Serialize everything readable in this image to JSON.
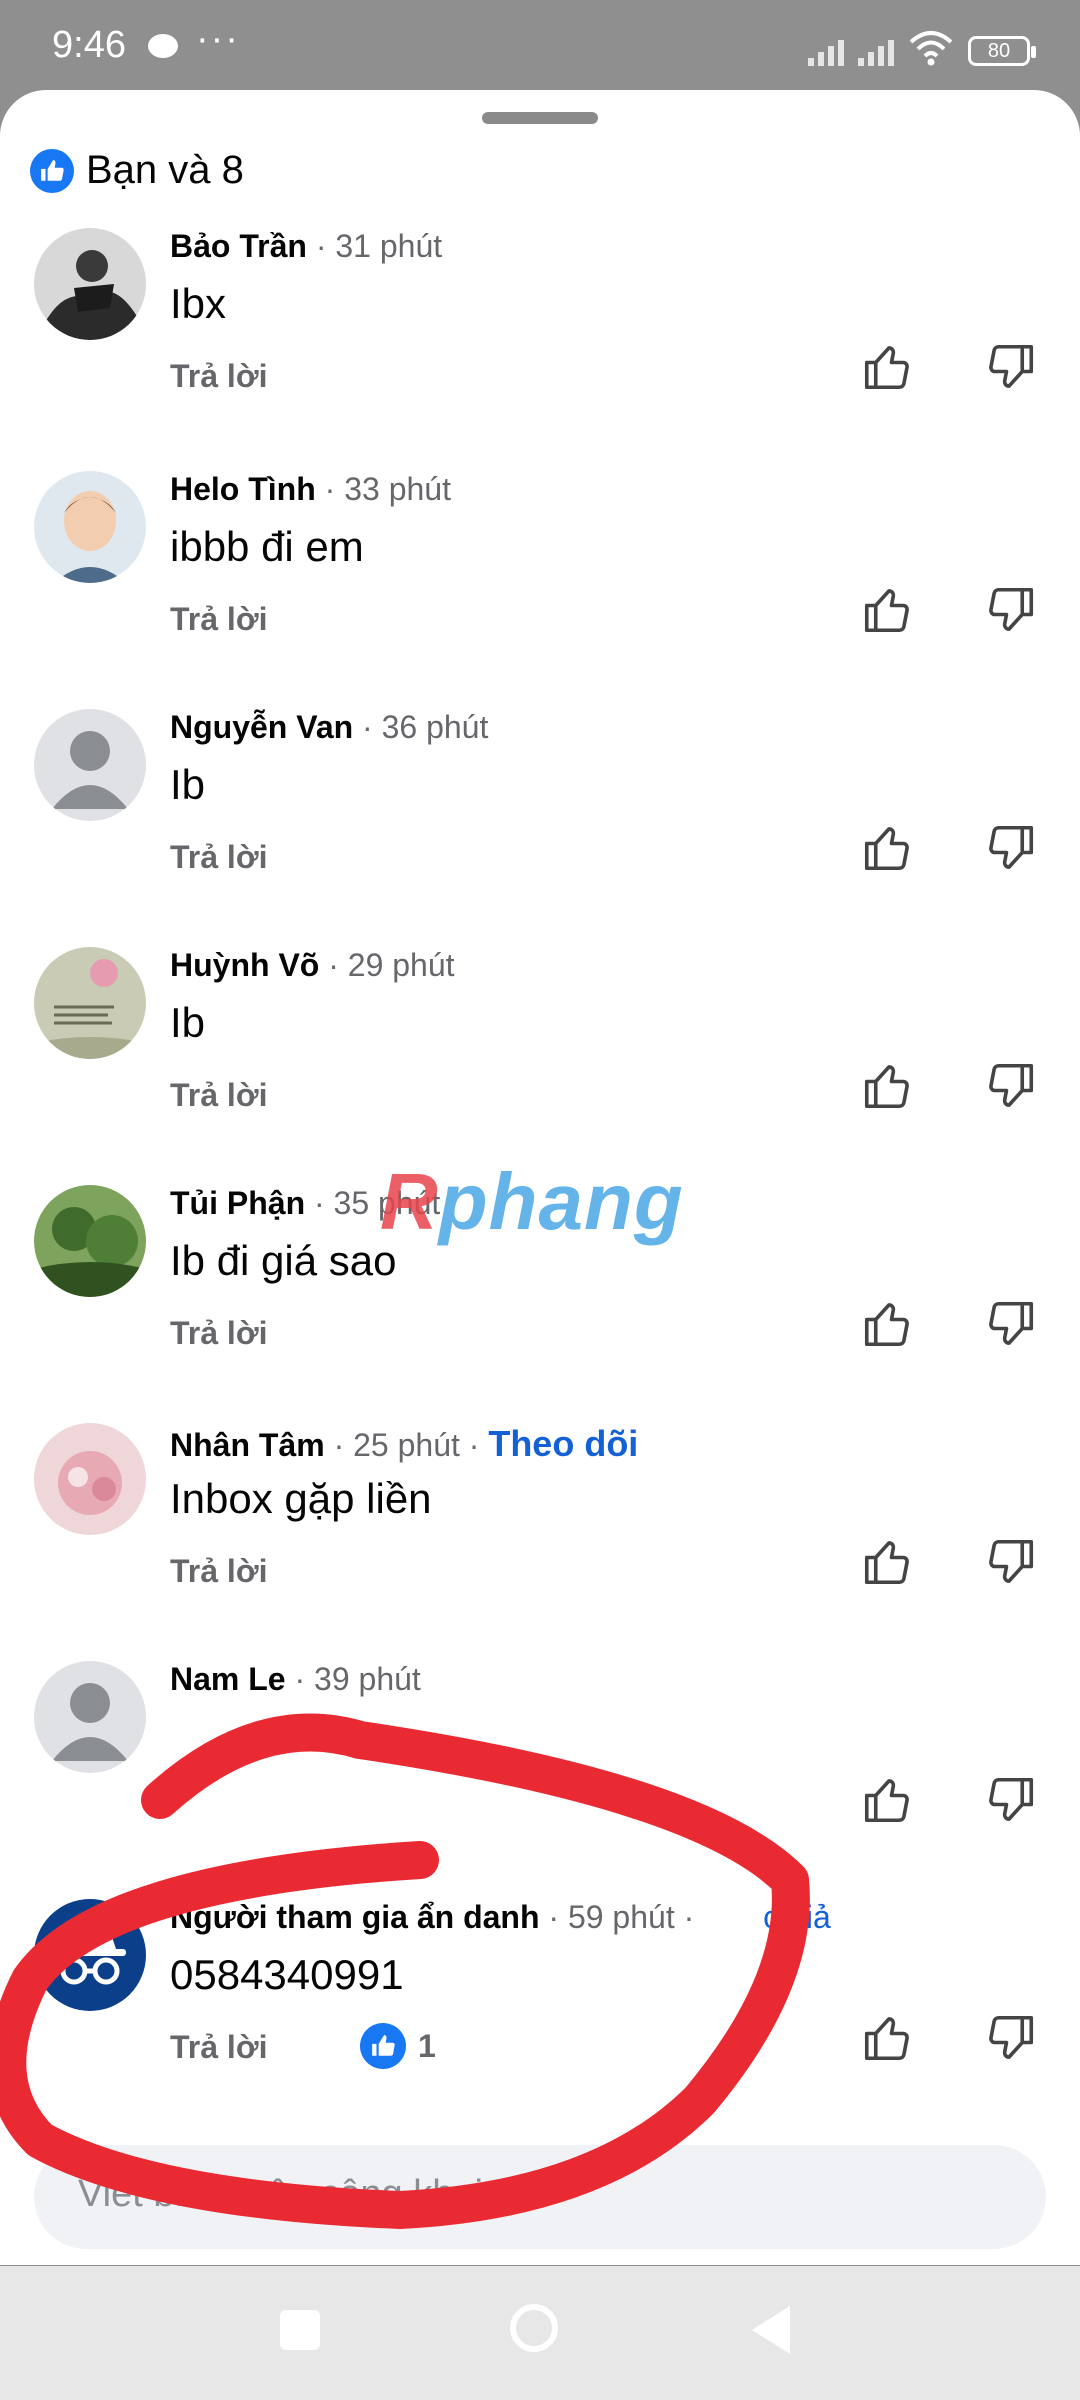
{
  "status_bar": {
    "time": "9:46",
    "dots": "···",
    "battery": "80"
  },
  "reactions": {
    "text": "Bạn và 8",
    "icon": "thumbs-up-icon"
  },
  "comments": [
    {
      "name": "Bảo Trần",
      "time": "· 31 phút",
      "text": "Ibx",
      "reply": "Trả lời"
    },
    {
      "name": "Helo Tình",
      "time": "· 33 phút",
      "text": "ibbb đi em",
      "reply": "Trả lời"
    },
    {
      "name": "Nguyễn Van",
      "time": "· 36 phút",
      "text": "Ib",
      "reply": "Trả lời"
    },
    {
      "name": "Huỳnh Võ",
      "time": "· 29 phút",
      "text": "Ib",
      "reply": "Trả lời"
    },
    {
      "name": "Tủi Phận",
      "time": "· 35 phút",
      "text": "Ib đi giá sao",
      "reply": "Trả lời"
    },
    {
      "name": "Nhân Tâm",
      "time": "· 25 phút ·",
      "follow": "Theo dõi",
      "text": "Inbox gặp liền",
      "reply": "Trả lời"
    },
    {
      "name": "Nam Le",
      "time": "· 39 phút",
      "text": "",
      "reply": ""
    },
    {
      "name": "Người tham gia ẩn danh",
      "time": "· 59 phút ·",
      "follow": "c giả",
      "text": "0584340991",
      "reply": "Trả lời",
      "likes": "1"
    }
  ],
  "composer": {
    "placeholder": "Viết bình luận công khai..."
  },
  "watermark": {
    "part1": "R",
    "part2": "phang"
  },
  "colors": {
    "accent": "#1877f2",
    "follow": "#1461d6",
    "annotation": "#ea2a33"
  }
}
